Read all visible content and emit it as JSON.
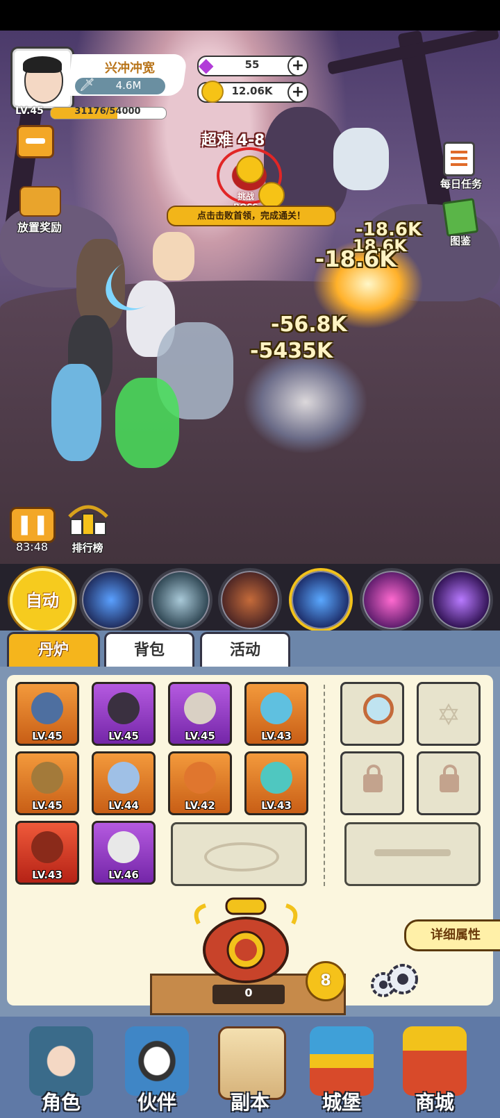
{
  "player": {
    "name": "兴冲冲宽",
    "power": "4.6M",
    "level": "LV.45",
    "exp": "31176/54000",
    "exp_fraction": 0.577
  },
  "currency": {
    "gems": "55",
    "gold": "12.06K"
  },
  "left_buttons": {
    "offline_reward": "放置奖励"
  },
  "right_buttons": {
    "daily_tasks": "每日任务",
    "codex": "图鉴"
  },
  "stage": {
    "title": "超难 4-8",
    "boss_label": "挑战BOSS",
    "tip": "点击击败首领，完成通关！"
  },
  "damage_numbers": [
    "-18.6K",
    "18.6K",
    "-18.6K",
    "-56.8K",
    "-5435K"
  ],
  "timer": {
    "time": "83:48",
    "ranking": "排行榜"
  },
  "skills": {
    "auto": "自动",
    "icons": [
      "fireball-skill-icon",
      "unicorn-skill-icon",
      "beast-skill-icon",
      "lightning-door-skill-icon",
      "vortex-skill-icon",
      "dark-swirl-skill-icon"
    ]
  },
  "tabs": [
    "丹炉",
    "背包",
    "活动"
  ],
  "equipment": [
    {
      "level": "LV.45",
      "rarity": "orange",
      "icon": "spear-icon"
    },
    {
      "level": "LV.45",
      "rarity": "purple",
      "icon": "armor-icon"
    },
    {
      "level": "LV.45",
      "rarity": "purple",
      "icon": "robe-icon"
    },
    {
      "level": "LV.43",
      "rarity": "orange",
      "icon": "orb-icon"
    },
    {
      "level": "LV.45",
      "rarity": "orange",
      "icon": "umbrella-icon"
    },
    {
      "level": "LV.44",
      "rarity": "orange",
      "icon": "shield-icon"
    },
    {
      "level": "LV.42",
      "rarity": "orange",
      "icon": "pendant-icon"
    },
    {
      "level": "LV.43",
      "rarity": "orange",
      "icon": "pearl-icon"
    },
    {
      "level": "LV.43",
      "rarity": "red",
      "icon": "amulet-icon"
    },
    {
      "level": "LV.46",
      "rarity": "purple",
      "icon": "boots-icon"
    }
  ],
  "detail_attributes": "详细属性",
  "furnace": {
    "count": "0",
    "level": "8"
  },
  "bottom_nav": [
    "角色",
    "伙伴",
    "副本",
    "城堡",
    "商城"
  ]
}
